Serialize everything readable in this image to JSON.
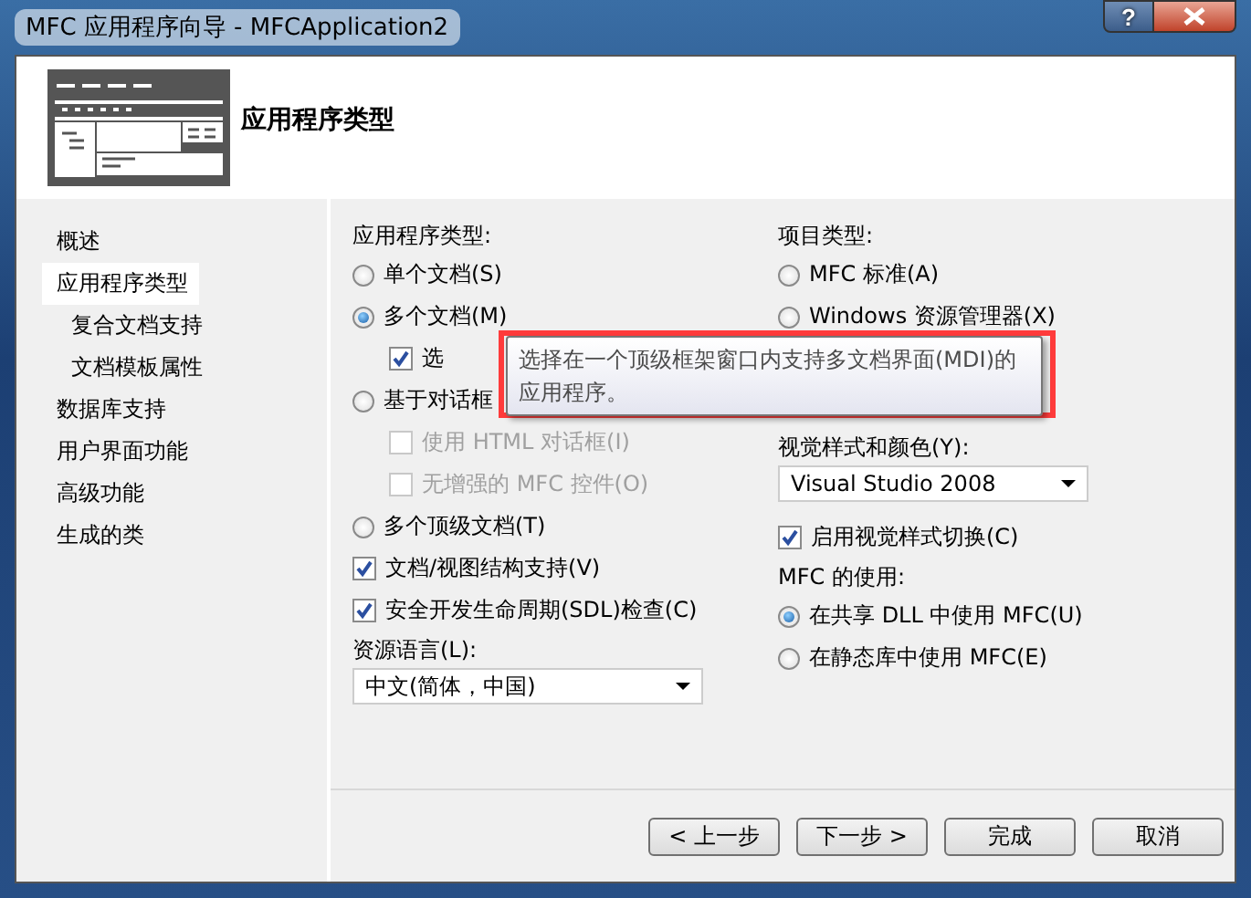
{
  "window": {
    "title": "MFC 应用程序向导 - MFCApplication2",
    "help": "?"
  },
  "header": {
    "title": "应用程序类型"
  },
  "nav": [
    {
      "label": "概述",
      "selected": false
    },
    {
      "label": "应用程序类型",
      "selected": true,
      "children": [
        {
          "label": "复合文档支持",
          "selected": false
        },
        {
          "label": "文档模板属性",
          "selected": false
        }
      ]
    },
    {
      "label": "数据库支持",
      "selected": false
    },
    {
      "label": "用户界面功能",
      "selected": false
    },
    {
      "label": "高级功能",
      "selected": false
    },
    {
      "label": "生成的类",
      "selected": false
    }
  ],
  "left": [
    {
      "kind": "label",
      "label": "应用程序类型:"
    },
    {
      "kind": "radio",
      "label": "单个文档(S)",
      "selected": false
    },
    {
      "kind": "radio",
      "label": "多个文档(M)",
      "selected": true,
      "children": [
        {
          "kind": "checkbox",
          "label": "选",
          "checked": true,
          "disabled": false
        }
      ]
    },
    {
      "kind": "radio",
      "label": "基于对话框",
      "selected": false,
      "children": [
        {
          "kind": "checkbox",
          "label": "使用 HTML 对话框(I)",
          "checked": false,
          "disabled": true
        },
        {
          "kind": "checkbox",
          "label": "无增强的 MFC 控件(O)",
          "checked": false,
          "disabled": true
        }
      ]
    },
    {
      "kind": "radio",
      "label": "多个顶级文档(T)",
      "selected": false
    },
    {
      "kind": "checkbox",
      "label": "文档/视图结构支持(V)",
      "checked": true,
      "disabled": false
    },
    {
      "kind": "checkbox",
      "label": "安全开发生命周期(SDL)检查(C)",
      "checked": true,
      "disabled": false
    },
    {
      "kind": "label",
      "label": "资源语言(L):"
    },
    {
      "kind": "dropdown",
      "label": "中文(简体，中国)"
    }
  ],
  "right": [
    {
      "kind": "label",
      "label": "项目类型:"
    },
    {
      "kind": "radio",
      "label": "MFC 标准(A)",
      "selected": false
    },
    {
      "kind": "radio",
      "label": "Windows 资源管理器(X)",
      "selected": false
    },
    {
      "kind": "spacer"
    },
    {
      "kind": "label",
      "label": "视觉样式和颜色(Y):"
    },
    {
      "kind": "dropdown",
      "label": "Visual Studio 2008"
    },
    {
      "kind": "checkbox",
      "label": "启用视觉样式切换(C)",
      "checked": true,
      "disabled": false
    },
    {
      "kind": "label",
      "label": "MFC 的使用:"
    },
    {
      "kind": "radio",
      "label": "在共享 DLL 中使用 MFC(U)",
      "selected": true
    },
    {
      "kind": "radio",
      "label": "在静态库中使用 MFC(E)",
      "selected": false
    }
  ],
  "tooltip": {
    "text": "选择在一个顶级框架窗口内支持多文档界面(MDI)的应用程序。"
  },
  "buttons": [
    {
      "label": "< 上一步"
    },
    {
      "label": "下一步 >"
    },
    {
      "label": "完成"
    },
    {
      "label": "取消"
    }
  ]
}
